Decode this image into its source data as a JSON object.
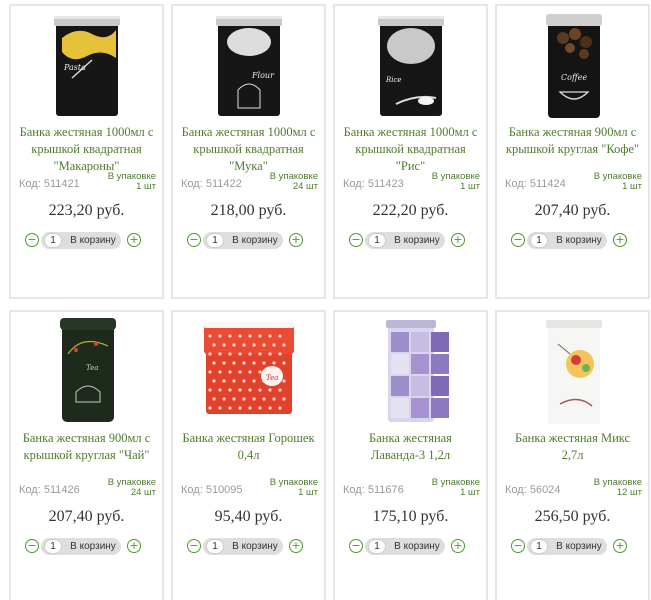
{
  "currency_suffix": "руб.",
  "pack_label": "В упаковке",
  "code_label": "Код:",
  "cart_label": "В корзину",
  "minus_label": "−",
  "plus_label": "+",
  "products": [
    {
      "title_lines": [
        "Банка жестяная 1000мл с",
        "крышкой квадратная",
        "\"Макароны\""
      ],
      "code": "511421",
      "pack": "1 шт",
      "price": "223,20 руб.",
      "qty": "1",
      "image_label": "Pasta",
      "icon": "pasta-tin-icon"
    },
    {
      "title_lines": [
        "Банка жестяная 1000мл с",
        "крышкой квадратная",
        "\"Мука\""
      ],
      "code": "511422",
      "pack": "24 шт",
      "price": "218,00 руб.",
      "qty": "1",
      "image_label": "Flour",
      "icon": "flour-tin-icon"
    },
    {
      "title_lines": [
        "Банка жестяная 1000мл с",
        "крышкой квадратная",
        "\"Рис\""
      ],
      "code": "511423",
      "pack": "1 шт",
      "price": "222,20 руб.",
      "qty": "1",
      "image_label": "Rice",
      "icon": "rice-tin-icon"
    },
    {
      "title_lines": [
        "Банка жестяная 900мл с",
        "крышкой круглая \"Кофе\""
      ],
      "code": "511424",
      "pack": "1 шт",
      "price": "207,40 руб.",
      "qty": "1",
      "image_label": "Coffee",
      "icon": "coffee-tin-icon"
    },
    {
      "title_lines": [
        "Банка жестяная 900мл с",
        "крышкой круглая \"Чай\""
      ],
      "code": "511426",
      "pack": "24 шт",
      "price": "207,40 руб.",
      "qty": "1",
      "image_label": "Tea",
      "icon": "tea-tin-icon"
    },
    {
      "title_lines": [
        "Банка жестяная Горошек",
        "0,4л"
      ],
      "code": "510095",
      "pack": "1 шт",
      "price": "95,40 руб.",
      "qty": "1",
      "image_label": "Tea",
      "icon": "polka-dot-tin-icon"
    },
    {
      "title_lines": [
        "Банка жестяная",
        "Лаванда-3 1,2л"
      ],
      "code": "511676",
      "pack": "1 шт",
      "price": "175,10 руб.",
      "qty": "1",
      "image_label": "",
      "icon": "lavender-tin-icon"
    },
    {
      "title_lines": [
        "Банка жестяная Микс",
        "2,7л"
      ],
      "code": "56024",
      "pack": "12 шт",
      "price": "256,50 руб.",
      "qty": "1",
      "image_label": "",
      "icon": "mix-tin-icon"
    }
  ]
}
